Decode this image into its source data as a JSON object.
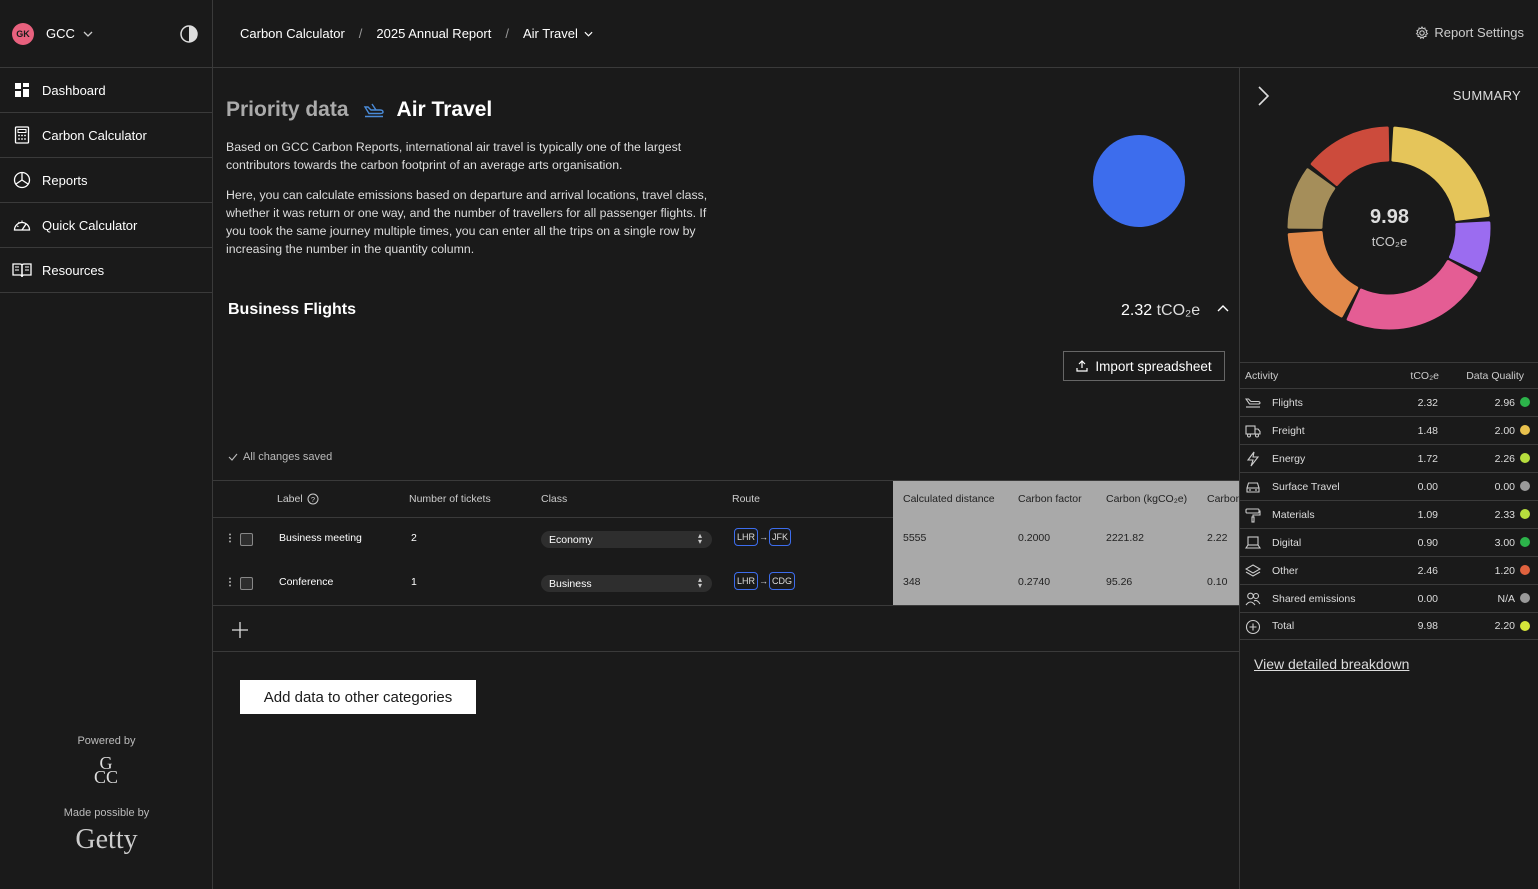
{
  "sidebar": {
    "avatar_initials": "GK",
    "org_name": "GCC",
    "items": [
      {
        "label": "Dashboard",
        "icon": "grid-icon"
      },
      {
        "label": "Carbon Calculator",
        "icon": "calculator-icon"
      },
      {
        "label": "Reports",
        "icon": "pie-chart-icon"
      },
      {
        "label": "Quick Calculator",
        "icon": "gauge-icon"
      },
      {
        "label": "Resources",
        "icon": "book-icon"
      }
    ],
    "powered_by": "Powered by",
    "made_possible_by": "Made possible by",
    "sponsor": "Getty",
    "logo_letters": {
      "top": "G",
      "bottom": "CC"
    }
  },
  "breadcrumb": {
    "items": [
      "Carbon Calculator",
      "2025 Annual Report",
      "Air Travel"
    ],
    "separator": "/"
  },
  "report_settings": "Report Settings",
  "page": {
    "priority_label": "Priority data",
    "title": "Air Travel",
    "paragraph1": "Based on GCC Carbon Reports, international air travel is typically one of the largest contributors towards the carbon footprint of an average arts organisation.",
    "paragraph2": "Here, you can calculate emissions based on departure and arrival locations, travel class, whether it was return or one way, and the number of travellers for all passenger flights. If you took the same journey multiple times, you can enter all the trips on a single row by increasing the number in the quantity column.",
    "accent_color": "#3d6ded"
  },
  "section": {
    "title": "Business Flights",
    "total_value": "2.32",
    "total_unit": "tCO₂e",
    "import_label": "Import spreadsheet",
    "saved_status": "All changes saved",
    "add_categories_label": "Add data to other categories"
  },
  "table": {
    "headers": {
      "label": "Label",
      "tickets": "Number of tickets",
      "class": "Class",
      "route": "Route",
      "distance": "Calculated distance",
      "factor": "Carbon factor",
      "carbon_kg": "Carbon (kgCO₂e)",
      "carbon_t": "Carbon"
    },
    "rows": [
      {
        "label": "Business meeting",
        "tickets": "2",
        "class": "Economy",
        "from": "LHR",
        "to": "JFK",
        "distance": "5555",
        "factor": "0.2000",
        "carbon_kg": "2221.82",
        "carbon_t": "2.22"
      },
      {
        "label": "Conference",
        "tickets": "1",
        "class": "Business",
        "from": "LHR",
        "to": "CDG",
        "distance": "348",
        "factor": "0.2740",
        "carbon_kg": "95.26",
        "carbon_t": "0.10"
      }
    ]
  },
  "summary": {
    "title": "SUMMARY",
    "total": "9.98",
    "unit": "tCO₂e",
    "headers": {
      "activity": "Activity",
      "tco2e": "tCO₂e",
      "quality": "Data Quality"
    },
    "rows": [
      {
        "activity": "Flights",
        "icon": "plane-icon",
        "value": "2.32",
        "quality": "2.96",
        "color": "#2cb34a"
      },
      {
        "activity": "Freight",
        "icon": "truck-icon",
        "value": "1.48",
        "quality": "2.00",
        "color": "#e8c14d"
      },
      {
        "activity": "Energy",
        "icon": "lightning-icon",
        "value": "1.72",
        "quality": "2.26",
        "color": "#b6dd3d"
      },
      {
        "activity": "Surface Travel",
        "icon": "car-icon",
        "value": "0.00",
        "quality": "0.00",
        "color": "#9a9a9a"
      },
      {
        "activity": "Materials",
        "icon": "paint-roller-icon",
        "value": "1.09",
        "quality": "2.33",
        "color": "#b6dd3d"
      },
      {
        "activity": "Digital",
        "icon": "laptop-icon",
        "value": "0.90",
        "quality": "3.00",
        "color": "#2cb34a"
      },
      {
        "activity": "Other",
        "icon": "layers-icon",
        "value": "2.46",
        "quality": "1.20",
        "color": "#e0623e"
      },
      {
        "activity": "Shared emissions",
        "icon": "people-icon",
        "value": "0.00",
        "quality": "N/A",
        "color": "#9a9a9a"
      },
      {
        "activity": "Total",
        "icon": "plus-circle-icon",
        "value": "9.98",
        "quality": "2.20",
        "color": "#d6e53a"
      }
    ],
    "donut_segments": [
      {
        "name": "Flights",
        "value": 2.32,
        "color": "#e5c55a"
      },
      {
        "name": "Digital",
        "value": 0.9,
        "color": "#9b6cf0"
      },
      {
        "name": "Other",
        "value": 2.46,
        "color": "#e45d94"
      },
      {
        "name": "Energy",
        "value": 1.72,
        "color": "#e2894a"
      },
      {
        "name": "Materials",
        "value": 1.09,
        "color": "#a58e5a"
      },
      {
        "name": "Freight",
        "value": 1.48,
        "color": "#cc4b3c"
      }
    ],
    "view_breakdown": "View detailed breakdown"
  }
}
